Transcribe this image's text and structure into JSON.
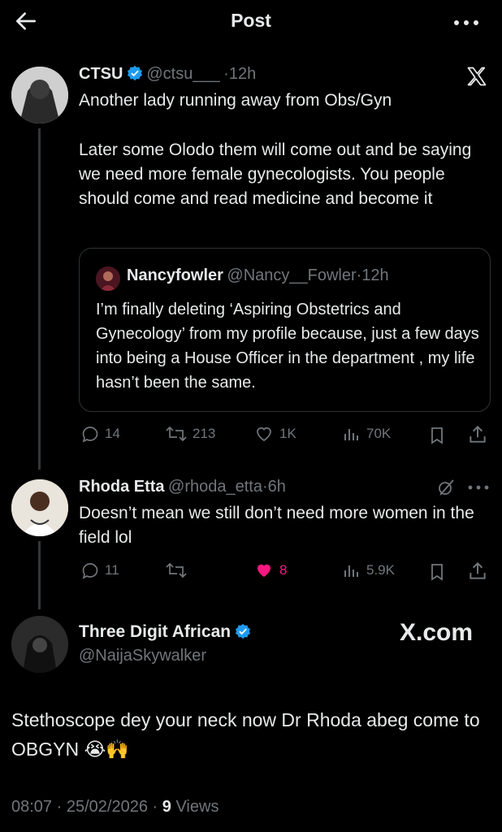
{
  "header": {
    "title": "Post"
  },
  "main_post": {
    "name": "CTSU",
    "handle": "@ctsu___",
    "time": "12h",
    "text_line1": "Another lady running away from Obs/Gyn",
    "text_para2": "Later some Olodo them will come out and be saying we need more female gynecologists. You people should come and read medicine and become it",
    "quote": {
      "name": "Nancyfowler",
      "handle": "@Nancy__Fowler",
      "time": "12h",
      "text": "I’m finally deleting ‘Aspiring Obstetrics and Gynecology’ from my profile because, just a few days into being a House Officer in the department , my life hasn’t been the same."
    },
    "stats": {
      "replies": "14",
      "reposts": "213",
      "likes": "1K",
      "views": "70K"
    }
  },
  "reply": {
    "name": "Rhoda Etta",
    "handle": "@rhoda_etta",
    "time": "6h",
    "text": "Doesn’t mean we still don’t need more women in the field lol",
    "stats": {
      "replies": "11",
      "reposts": "",
      "likes": "8",
      "views": "5.9K"
    }
  },
  "focused": {
    "name": "Three Digit African",
    "handle": "@NaijaSkywalker",
    "text": "Stethoscope dey your neck now Dr Rhoda abeg come to OBGYN 😭🙌",
    "time": "08:07",
    "date": "25/02/2026",
    "views_count": "9",
    "views_label": "Views",
    "watermark": "X.com"
  },
  "colors": {
    "accent": "#1d9bf0",
    "like": "#f91880",
    "muted": "#71767b",
    "text": "#e7e9ea"
  },
  "icons": [
    "back-arrow-icon",
    "more-icon",
    "x-logo-icon",
    "verified-icon",
    "reply-icon",
    "repost-icon",
    "like-icon",
    "views-icon",
    "bookmark-icon",
    "share-icon",
    "grok-icon"
  ]
}
